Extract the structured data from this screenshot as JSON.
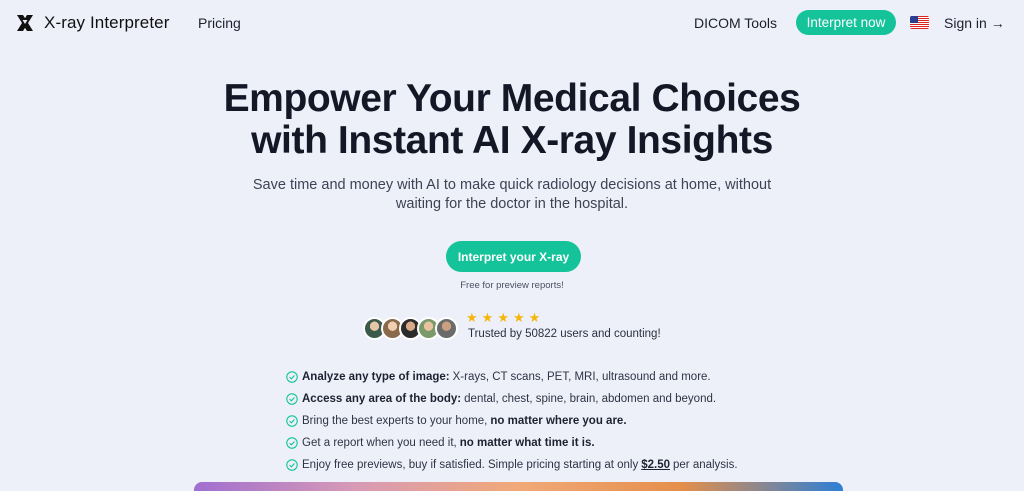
{
  "header": {
    "brand": "X-ray Interpreter",
    "nav_pricing": "Pricing",
    "nav_dicom": "DICOM Tools",
    "cta_label": "Interpret now",
    "signin_label": "Sign in →"
  },
  "hero": {
    "headline_line1": "Empower Your Medical Choices",
    "headline_line2": "with Instant AI X-ray Insights",
    "subhead_line1": "Save time and money with AI to make quick radiology decisions at home, without",
    "subhead_line2": "waiting for the doctor in the hospital.",
    "cta_label": "Interpret your X-ray",
    "free_note": "Free for preview reports!"
  },
  "social_proof": {
    "rating_stars": 5,
    "trusted_text": "Trusted by 50822 users and counting!"
  },
  "features": [
    {
      "bold": "Analyze any type of image:",
      "text": "X-rays, CT scans, PET, MRI, ultrasound and more."
    },
    {
      "bold": "Access any area of the body:",
      "text": "dental, chest, spine, brain, abdomen and beyond."
    },
    {
      "text": "Bring the best experts to your home,",
      "bold": "no matter where you are."
    },
    {
      "text": "Get a report when you need it,",
      "bold": "no matter what time it is."
    },
    {
      "text": "Enjoy free previews, buy if satisfied. Simple pricing starting at only",
      "price": "$2.50",
      "suffix": "per analysis."
    }
  ],
  "colors": {
    "accent": "#14c39a",
    "background": "#eef0f9",
    "star": "#f5b60a"
  },
  "icons": {
    "logo": "x-logo-icon",
    "flag": "us-flag-icon",
    "check": "check-circle-icon",
    "star": "star-icon"
  }
}
